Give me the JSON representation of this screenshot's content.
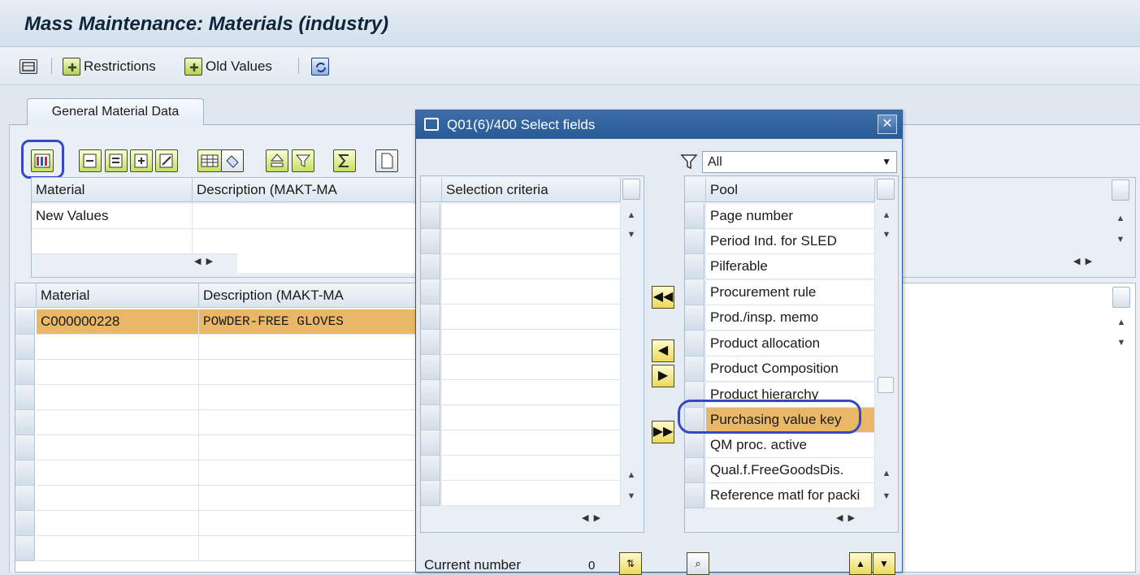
{
  "window": {
    "title": "Mass Maintenance: Materials (industry)"
  },
  "toolbar": {
    "restrictions_label": "Restrictions",
    "old_values_label": "Old Values"
  },
  "tabs": [
    {
      "label": "General Material Data"
    }
  ],
  "upper_table": {
    "columns": [
      "Material",
      "Description (MAKT-MA"
    ],
    "rows": [
      [
        "New Values",
        ""
      ],
      [
        "",
        ""
      ]
    ]
  },
  "lower_table": {
    "columns": [
      "Material",
      "Description (MAKT-MA"
    ],
    "rows": [
      [
        "C000000228",
        "POWDER-FREE GLOVES"
      ]
    ]
  },
  "dialog": {
    "title": "Q01(6)/400 Select fields",
    "filter_value": "All",
    "selection_header": "Selection criteria",
    "pool_header": "Pool",
    "pool_items": [
      "Page number",
      "Period Ind. for SLED",
      "Pilferable",
      "Procurement rule",
      "Prod./insp. memo",
      "Product allocation",
      "Product Composition",
      "Product hierarchy",
      "Purchasing value key",
      "QM proc. active",
      "Qual.f.FreeGoodsDis.",
      "Reference matl for packi"
    ],
    "selected_pool_item": "Purchasing value key",
    "current_number_label": "Current number",
    "current_number_value": "0"
  },
  "colors": {
    "highlight": "#e8b768",
    "annotation": "#3648c4",
    "dialog_title": "#2f5e97"
  }
}
